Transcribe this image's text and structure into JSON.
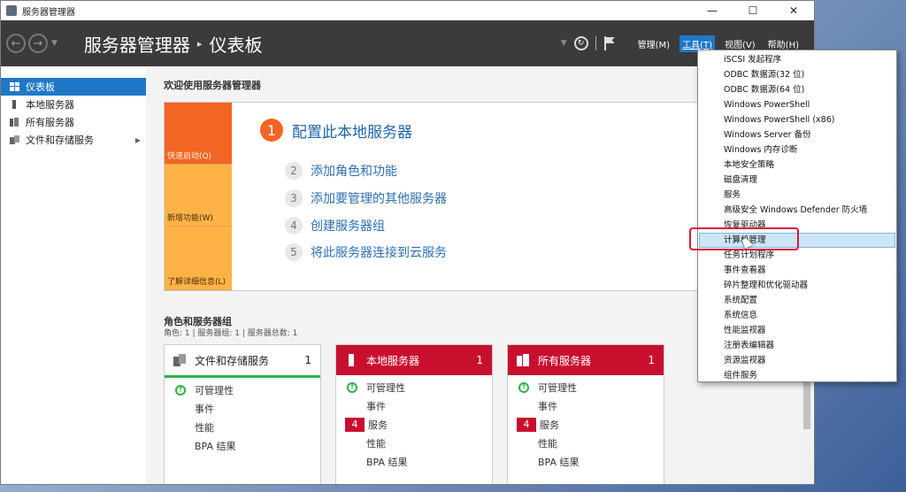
{
  "window": {
    "title": "服务器管理器",
    "controls": {
      "minimize": "—",
      "maximize": "☐",
      "close": "✕"
    }
  },
  "header": {
    "app": "服务器管理器",
    "page": "仪表板",
    "menus": [
      {
        "label": "管理(M)"
      },
      {
        "label": "工具(T)"
      },
      {
        "label": "视图(V)"
      },
      {
        "label": "帮助(H)"
      }
    ]
  },
  "sidebar": {
    "items": [
      {
        "label": "仪表板"
      },
      {
        "label": "本地服务器"
      },
      {
        "label": "所有服务器"
      },
      {
        "label": "文件和存储服务"
      }
    ]
  },
  "welcome": {
    "title": "欢迎使用服务器管理器",
    "quickstart": {
      "quick_start": "快速启动(Q)",
      "whats_new": "新增功能(W)",
      "learn_more": "了解详细信息(L)"
    },
    "steps": [
      {
        "num": "1",
        "label": "配置此本地服务器"
      },
      {
        "num": "2",
        "label": "添加角色和功能"
      },
      {
        "num": "3",
        "label": "添加要管理的其他服务器"
      },
      {
        "num": "4",
        "label": "创建服务器组"
      },
      {
        "num": "5",
        "label": "将此服务器连接到云服务"
      }
    ]
  },
  "roles": {
    "title": "角色和服务器组",
    "subtitle": "角色: 1 | 服务器组: 1 | 服务器总数: 1",
    "cards": [
      {
        "name": "文件和存储服务",
        "count": "1",
        "rows": {
          "manageability": "可管理性",
          "events": "事件",
          "performance": "性能",
          "bpa": "BPA 结果"
        }
      },
      {
        "name": "本地服务器",
        "count": "1",
        "services_badge": "4",
        "rows": {
          "manageability": "可管理性",
          "events": "事件",
          "services": "服务",
          "performance": "性能",
          "bpa": "BPA 结果"
        }
      },
      {
        "name": "所有服务器",
        "count": "1",
        "services_badge": "4",
        "rows": {
          "manageability": "可管理性",
          "events": "事件",
          "services": "服务",
          "performance": "性能",
          "bpa": "BPA 结果"
        }
      }
    ]
  },
  "tools_menu": {
    "items": [
      "iSCSI 发起程序",
      "ODBC 数据源(32 位)",
      "ODBC 数据源(64 位)",
      "Windows PowerShell",
      "Windows PowerShell (x86)",
      "Windows Server 备份",
      "Windows 内存诊断",
      "本地安全策略",
      "磁盘清理",
      "服务",
      "高级安全 Windows Defender 防火墙",
      "恢复驱动器",
      "计算机管理",
      "任务计划程序",
      "事件查看器",
      "碎片整理和优化驱动器",
      "系统配置",
      "系统信息",
      "性能监视器",
      "注册表编辑器",
      "资源监视器",
      "组件服务"
    ]
  },
  "colors": {
    "accent": "#1e78c8",
    "quickstart_orange": "#f26522",
    "quickstart_light": "#ffb347",
    "alert_red": "#c8102e",
    "ok_green": "#2db34a",
    "highlight_red": "#d6173a"
  }
}
